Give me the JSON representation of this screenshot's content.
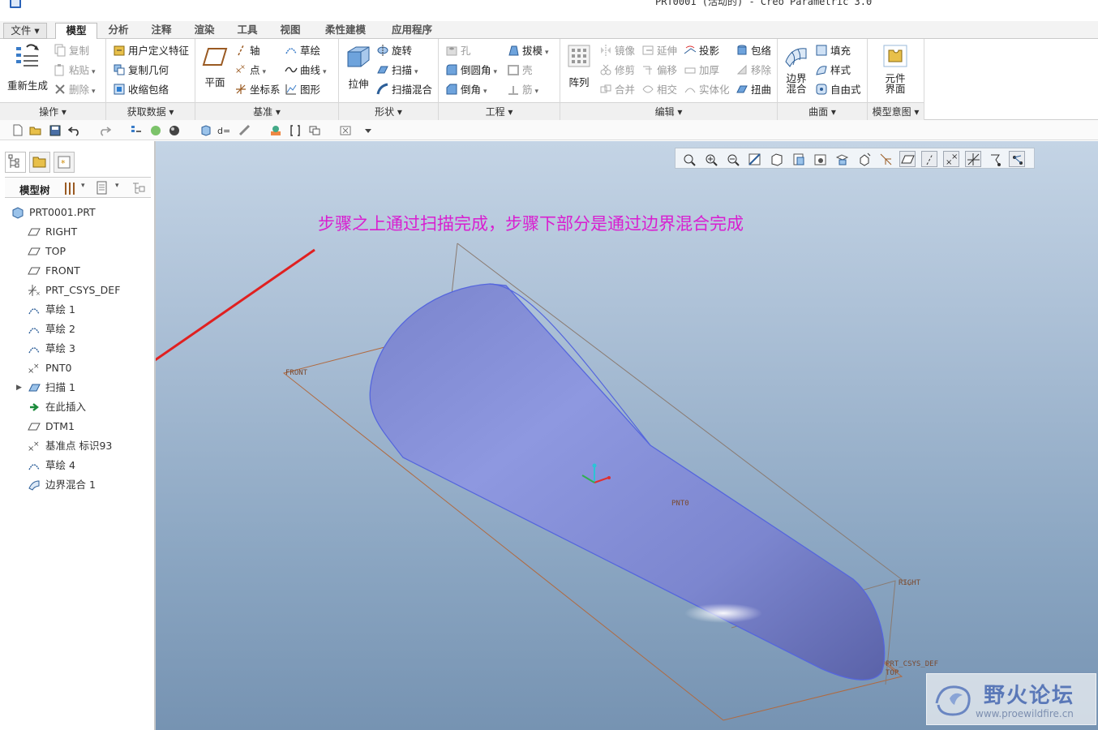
{
  "window": {
    "title": "PRT0001 (活动的) - Creo Parametric 3.0"
  },
  "tabs": [
    {
      "label": "文件 ▾"
    },
    {
      "label": "模型"
    },
    {
      "label": "分析"
    },
    {
      "label": "注释"
    },
    {
      "label": "渲染"
    },
    {
      "label": "工具"
    },
    {
      "label": "视图"
    },
    {
      "label": "柔性建模"
    },
    {
      "label": "应用程序"
    }
  ],
  "ribbon": {
    "operations": {
      "regenerate": "重新生成",
      "copy": "复制",
      "paste": "粘贴",
      "delete": "删除",
      "label": "操作 ▾"
    },
    "get_data": {
      "udf": "用户定义特征",
      "copy_geom": "复制几何",
      "shrinkwrap": "收缩包络",
      "label": "获取数据 ▾"
    },
    "datum": {
      "plane": "平面",
      "axis": "轴",
      "point": "点",
      "csys": "坐标系",
      "sketch": "草绘",
      "curve": "曲线",
      "graph": "图形",
      "label": "基准 ▾"
    },
    "shapes": {
      "extrude": "拉伸",
      "revolve": "旋转",
      "sweep": "扫描",
      "swept_blend": "扫描混合",
      "label": "形状 ▾"
    },
    "engineering": {
      "hole": "孔",
      "round": "倒圆角",
      "chamfer": "倒角",
      "draft": "拔模",
      "shell": "壳",
      "rib": "筋",
      "label": "工程 ▾"
    },
    "editing": {
      "pattern": "阵列",
      "mirror": "镜像",
      "trim": "修剪",
      "merge": "合并",
      "extend": "延伸",
      "offset": "偏移",
      "intersect": "相交",
      "project": "投影",
      "thicken": "加厚",
      "solidify": "实体化",
      "wrap": "包络",
      "remove": "移除",
      "twist": "扭曲",
      "label": "编辑 ▾"
    },
    "surfaces": {
      "boundary_blend": "边界混合",
      "fill": "填充",
      "style": "样式",
      "freestyle": "自由式",
      "label": "曲面 ▾"
    },
    "model_intent": {
      "component_interface": "元件界面",
      "label": "模型意图 ▾"
    }
  },
  "tree": {
    "toolbar_label": "模型树",
    "items": [
      {
        "label": "PRT0001.PRT",
        "icon": "part-icon"
      },
      {
        "label": "RIGHT",
        "icon": "datum-plane-icon"
      },
      {
        "label": "TOP",
        "icon": "datum-plane-icon"
      },
      {
        "label": "FRONT",
        "icon": "datum-plane-icon"
      },
      {
        "label": "PRT_CSYS_DEF",
        "icon": "csys-icon"
      },
      {
        "label": "草绘 1",
        "icon": "sketch-icon"
      },
      {
        "label": "草绘 2",
        "icon": "sketch-icon"
      },
      {
        "label": "草绘 3",
        "icon": "sketch-icon"
      },
      {
        "label": "PNT0",
        "icon": "datum-point-icon"
      },
      {
        "label": "扫描 1",
        "icon": "sweep-icon"
      },
      {
        "label": "在此插入",
        "icon": "insert-here-icon"
      },
      {
        "label": "DTM1",
        "icon": "datum-plane-icon"
      },
      {
        "label": "基准点 标识93",
        "icon": "datum-point-icon"
      },
      {
        "label": "草绘 4",
        "icon": "sketch-icon"
      },
      {
        "label": "边界混合 1",
        "icon": "boundary-blend-icon"
      }
    ]
  },
  "viewport": {
    "annotation": "步骤之上通过扫描完成，步骤下部分是通过边界混合完成",
    "datum_labels": {
      "front": "FRONT",
      "right": "RIGHT",
      "top": "TOP",
      "csys": "PRT_CSYS_DEF",
      "pnt": "PNT0"
    },
    "watermark": {
      "title": "野火论坛",
      "url": "www.proewildfire.cn"
    }
  },
  "colors": {
    "annotation": "#d81fd0",
    "model_fill": "#8d96dc",
    "datum_line": "#b06a40",
    "arrow": "#e02020"
  }
}
